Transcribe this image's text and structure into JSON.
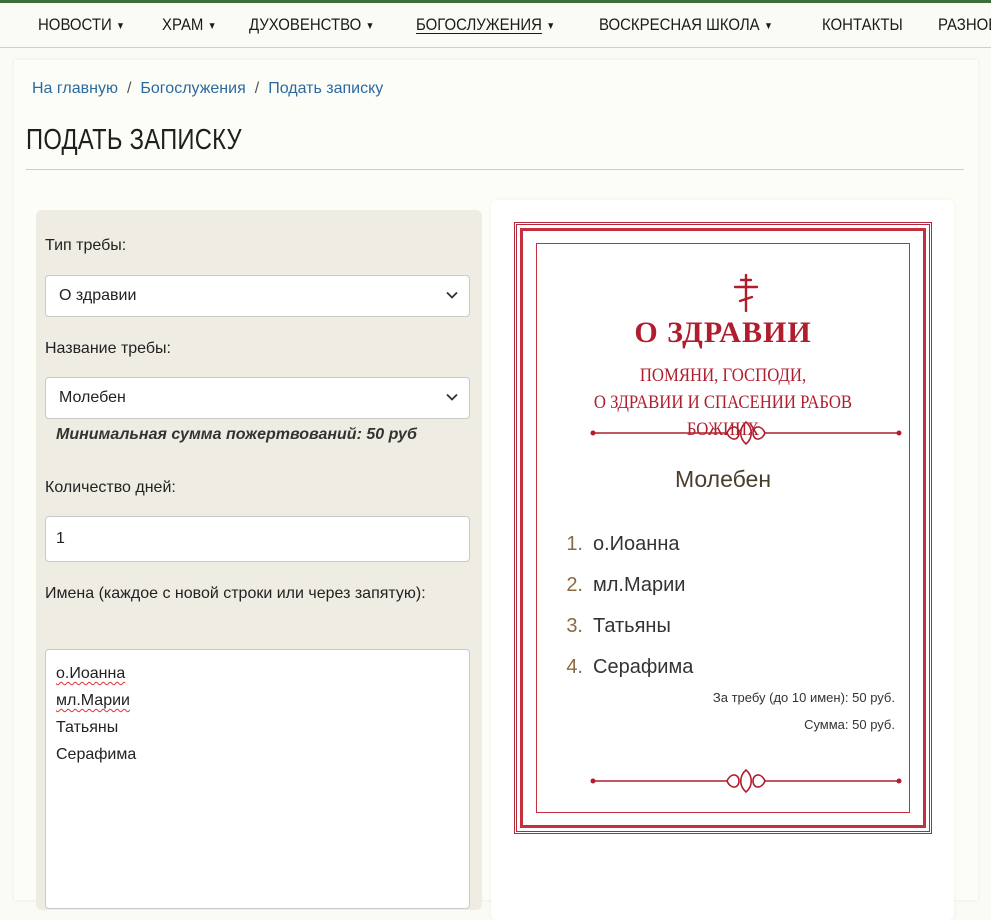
{
  "nav": {
    "items": [
      {
        "label": "Новости",
        "caret": true
      },
      {
        "label": "Храм",
        "caret": true
      },
      {
        "label": "Духовенство",
        "caret": true
      },
      {
        "label": "Богослужения",
        "caret": true,
        "active": true
      },
      {
        "label": "Воскресная школа",
        "caret": true
      },
      {
        "label": "Контакты",
        "caret": false
      },
      {
        "label": "Разное",
        "caret": true
      }
    ]
  },
  "breadcrumb": [
    "На главную",
    "Богослужения",
    "Подать записку"
  ],
  "page": {
    "title": "ПОДАТЬ ЗАПИСКУ"
  },
  "form": {
    "type_label": "Тип требы:",
    "type_value": "О здравии",
    "name_label": "Название требы:",
    "name_value": "Молебен",
    "min_donation": "Минимальная сумма пожертвований: 50 руб",
    "days_label": "Количество дней:",
    "days_value": "1",
    "names_label": "Имена (каждое с новой строки или через запятую):",
    "names_lines": [
      "о.Иоанна",
      "мл.Марии",
      "Татьяны",
      "Серафима"
    ]
  },
  "preview": {
    "title": "О здравии",
    "subtitle_line1": "Помяни, Господи,",
    "subtitle_line2": "о здравии и спасении рабов Божиих",
    "trebe": "Молебен",
    "names": [
      {
        "num": "1.",
        "name": "о.Иоанна"
      },
      {
        "num": "2.",
        "name": "мл.Марии"
      },
      {
        "num": "3.",
        "name": "Татьяны"
      },
      {
        "num": "4.",
        "name": "Серафима"
      }
    ],
    "price_per": "За требу (до 10 имен): 50 руб.",
    "total": "Сумма: 50 руб."
  },
  "colors": {
    "accent_red": "#b01e2e",
    "nav_line": "#3e6b3a",
    "link": "#2a6aa0",
    "form_bg": "#efede3"
  },
  "icons": {
    "caret": "caret-down-icon",
    "chevron": "chevron-down-icon",
    "cross": "orthodox-cross-icon"
  }
}
